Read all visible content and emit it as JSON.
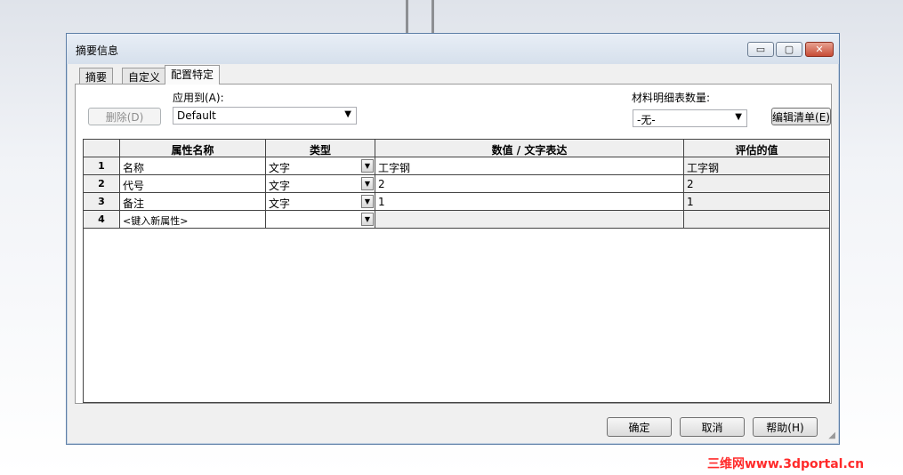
{
  "window": {
    "title": "摘要信息",
    "min_glyph": "▭",
    "max_glyph": "▢",
    "close_glyph": "✕"
  },
  "tabs": [
    {
      "label": "摘要"
    },
    {
      "label": "自定义"
    },
    {
      "label": "配置特定"
    }
  ],
  "toolbar": {
    "delete_label": "删除(D)",
    "apply_to_label": "应用到(A):",
    "apply_to_value": "Default",
    "bom_qty_label": "材料明细表数量:",
    "bom_qty_value": "-无-",
    "edit_list_label": "编辑清单(E)"
  },
  "table": {
    "headers": [
      "属性名称",
      "类型",
      "数值 / 文字表达",
      "评估的值"
    ],
    "rows": [
      {
        "num": "1",
        "name": "名称",
        "type": "文字",
        "value": "工字钢",
        "evaluated": "工字钢"
      },
      {
        "num": "2",
        "name": "代号",
        "type": "文字",
        "value": "2",
        "evaluated": "2"
      },
      {
        "num": "3",
        "name": "备注",
        "type": "文字",
        "value": "1",
        "evaluated": "1"
      },
      {
        "num": "4",
        "name": "<键入新属性>",
        "type": "",
        "value": "",
        "evaluated": ""
      }
    ]
  },
  "footer": {
    "ok_label": "确定",
    "cancel_label": "取消",
    "help_label": "帮助(H)"
  },
  "watermark": "三维网www.3dportal.cn",
  "icons": {
    "dropdown": "chevron-down-icon"
  },
  "colors": {
    "title_bar": "#d6e0ec",
    "close_button": "#c74c36",
    "watermark": "#ff2a2a"
  }
}
